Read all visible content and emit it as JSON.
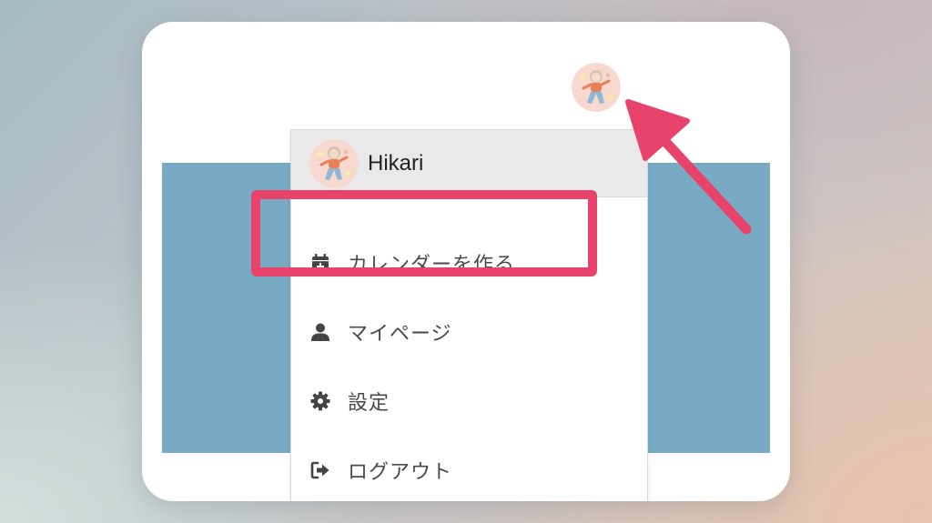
{
  "user": {
    "name": "Hikari"
  },
  "menu": {
    "items": [
      {
        "label": "カレンダーを作る",
        "icon": "calendar-plus-icon"
      },
      {
        "label": "マイページ",
        "icon": "user-icon"
      },
      {
        "label": "設定",
        "icon": "gear-icon"
      },
      {
        "label": "ログアウト",
        "icon": "sign-out-icon"
      }
    ]
  },
  "annotation": {
    "highlighted_item": "カレンダーを作る",
    "color": "#e8436b"
  },
  "colors": {
    "banner": "#79aac4",
    "menu_header": "#e9e9e9",
    "icon": "#444444"
  }
}
